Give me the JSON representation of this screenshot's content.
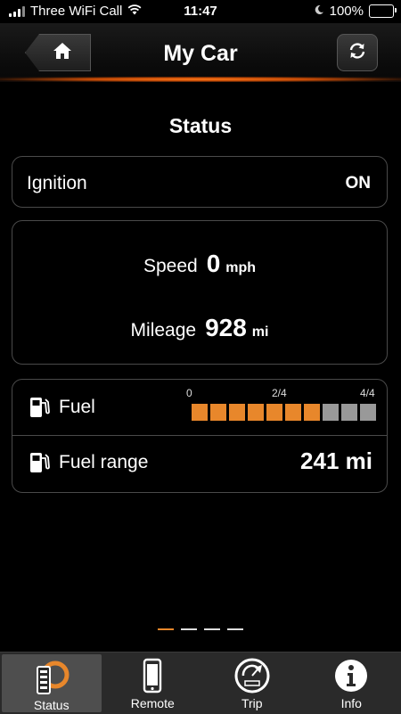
{
  "status_bar": {
    "carrier": "Three WiFi Call",
    "time": "11:47",
    "battery": "100%"
  },
  "header": {
    "title": "My Car"
  },
  "section_title": "Status",
  "ignition": {
    "label": "Ignition",
    "value": "ON"
  },
  "speed": {
    "label": "Speed",
    "value": "0",
    "unit": "mph"
  },
  "mileage": {
    "label": "Mileage",
    "value": "928",
    "unit": "mi"
  },
  "fuel": {
    "label": "Fuel",
    "scale_labels": [
      "0",
      "2/4",
      "4/4"
    ],
    "segments_total": 10,
    "segments_filled": 7,
    "filled_color": "#e8872b",
    "empty_color": "#999999"
  },
  "fuel_range": {
    "label": "Fuel range",
    "value": "241 mi"
  },
  "pager": {
    "pages": 4,
    "active": 0
  },
  "tabs": [
    {
      "label": "Status",
      "icon": "status-icon",
      "active": true
    },
    {
      "label": "Remote",
      "icon": "phone-icon",
      "active": false
    },
    {
      "label": "Trip",
      "icon": "trip-icon",
      "active": false
    },
    {
      "label": "Info",
      "icon": "info-icon",
      "active": false
    }
  ],
  "colors": {
    "accent": "#e8872b",
    "background": "#000000"
  }
}
